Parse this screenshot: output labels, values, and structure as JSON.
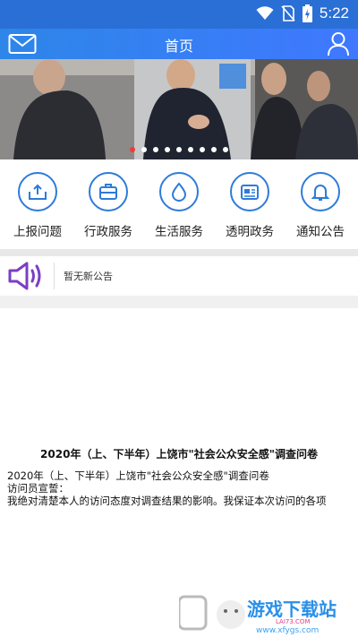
{
  "status_bar": {
    "time": "5:22",
    "icons": [
      "wifi-icon",
      "no-sim-icon",
      "battery-charging-icon"
    ],
    "bg_color": "#2a6fd6"
  },
  "header": {
    "title": "首页",
    "left_icon": "mail-icon",
    "right_icon": "user-icon",
    "accent": "#3a80ec"
  },
  "banner": {
    "slide_count": 9,
    "active_index": 0
  },
  "services": [
    {
      "label": "上报问题",
      "icon": "upload-tray-icon"
    },
    {
      "label": "行政服务",
      "icon": "briefcase-icon"
    },
    {
      "label": "生活服务",
      "icon": "water-drop-icon"
    },
    {
      "label": "透明政务",
      "icon": "newspaper-icon"
    },
    {
      "label": "通知公告",
      "icon": "bell-icon"
    }
  ],
  "notice": {
    "icon": "speaker-icon",
    "text": "暂无新公告"
  },
  "article": {
    "title": "2020年（上、下半年）上饶市\"社会公众安全感\"调查问卷",
    "lines": [
      "2020年（上、下半年）上饶市\"社会公众安全感\"调查问卷",
      "访问员宣誓：",
      "我绝对清楚本人的访问态度对调查结果的影响。我保证本次访问的各项"
    ]
  },
  "watermark": {
    "text": "游戏下载站",
    "sub": "LAI73.COM",
    "url": "www.xfygs.com"
  }
}
